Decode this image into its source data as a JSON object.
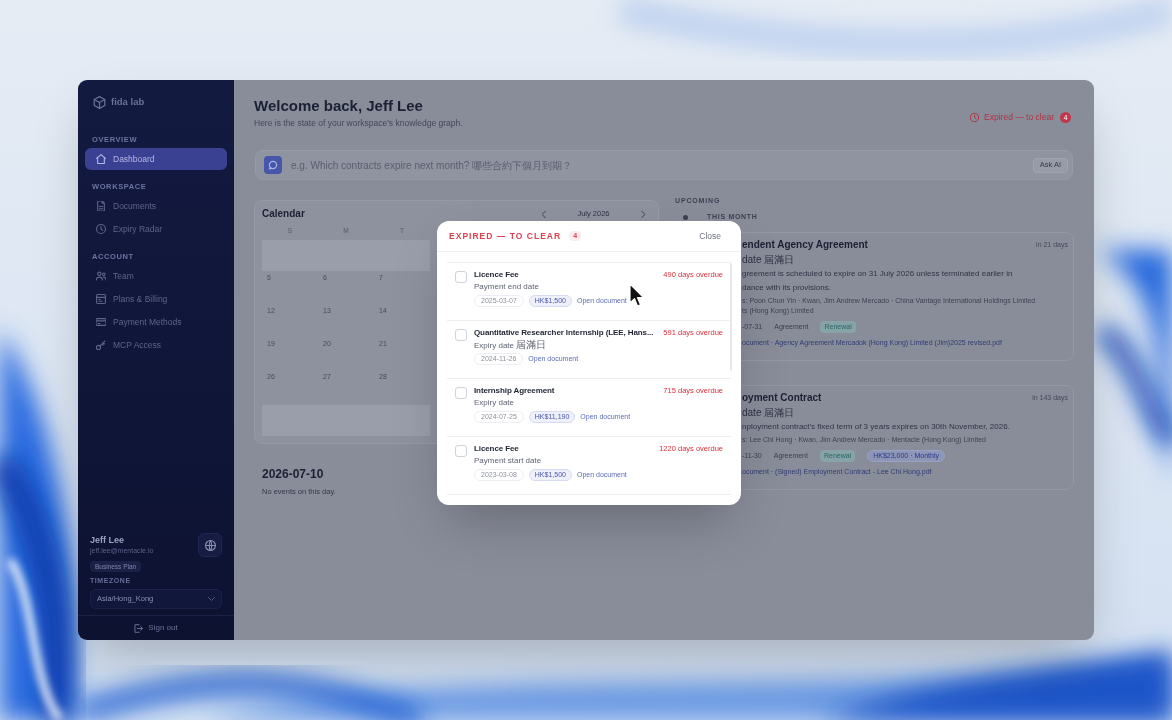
{
  "sidebar": {
    "logo": "fida lab",
    "sections": [
      {
        "heading": "OVERVIEW",
        "items": [
          {
            "label": "Dashboard",
            "selected": true
          }
        ]
      },
      {
        "heading": "WORKSPACE",
        "items": [
          {
            "label": "Documents",
            "selected": false
          },
          {
            "label": "Expiry Radar",
            "selected": false
          }
        ]
      },
      {
        "heading": "ACCOUNT",
        "items": [
          {
            "label": "Team",
            "selected": false
          },
          {
            "label": "Plans & Billing",
            "selected": false
          },
          {
            "label": "Payment Methods",
            "selected": false
          },
          {
            "label": "MCP Access",
            "selected": false
          }
        ]
      }
    ],
    "user": {
      "name": "Jeff Lee",
      "email": "jeff.lee@mentacle.io",
      "plan": "Business Plan"
    },
    "timezone": {
      "label": "TIMEZONE",
      "value": "Asia/Hong_Kong"
    },
    "sign_out": "Sign out"
  },
  "header": {
    "title": "Welcome back, Jeff Lee",
    "subtitle": "Here is the state of your workspace's knowledge graph.",
    "expired_link": {
      "label": "Expired — to clear",
      "count": "4"
    }
  },
  "ask_bar": {
    "placeholder": "e.g. Which contracts expire next month? 哪些合約下個月到期？",
    "button": "Ask AI"
  },
  "calendar": {
    "title": "Calendar",
    "month": "July 2026",
    "weekdays": [
      "S",
      "M",
      "T"
    ],
    "weeks": [
      [
        {
          "kind": "blank"
        },
        {
          "kind": "blank"
        },
        {
          "kind": "blank"
        }
      ],
      [
        {
          "kind": "day",
          "day": "5"
        },
        {
          "kind": "day",
          "day": "6"
        },
        {
          "kind": "day",
          "day": "7"
        }
      ],
      [
        {
          "kind": "day",
          "day": "12"
        },
        {
          "kind": "day",
          "day": "13"
        },
        {
          "kind": "day",
          "day": "14"
        }
      ],
      [
        {
          "kind": "day",
          "day": "19"
        },
        {
          "kind": "day",
          "day": "20"
        },
        {
          "kind": "day",
          "day": "21"
        }
      ],
      [
        {
          "kind": "day",
          "day": "26"
        },
        {
          "kind": "day",
          "day": "27"
        },
        {
          "kind": "day",
          "day": "28"
        }
      ],
      [
        {
          "kind": "blank"
        },
        {
          "kind": "blank"
        },
        {
          "kind": "blank"
        }
      ]
    ]
  },
  "selected_day": {
    "date": "2026-07-10",
    "message": "No events on this day."
  },
  "upcoming": {
    "heading": "UPCOMING",
    "group": "THIS MONTH",
    "cards": [
      {
        "title": "endent Agency Agreement",
        "due": "in 21 days",
        "subtitle": "date 屆滿日",
        "description": [
          "greement is scheduled to expire on 31 July 2026 unless terminated earlier in",
          "dance with its provisions."
        ],
        "parties": [
          "s: Poon Chun Yin · Kwan, Jim Andrew Mercado · China Vantage International Holdings Limited",
          "ts (Hong Kong) Limited"
        ],
        "date": "-07-31",
        "tags": [
          {
            "kind": "plain",
            "label": "Agreement"
          },
          {
            "kind": "renewal",
            "label": "Renewal"
          }
        ],
        "document": "ocument · Agency Agreement Mercadok (Hong Kong) Limited (Jim)2025 revised.pdf"
      },
      {
        "title": "oyment Contract",
        "due": "in 143 days",
        "subtitle": "date 屆滿日",
        "description": [
          "nployment contract's fixed term of 3 years expires on 30th November, 2026."
        ],
        "parties": [
          "s: Lee Chi Hong · Kwan, Jim Andrew Mercado · Mentacle (Hong Kong) Limited"
        ],
        "date": "-11-30",
        "tags": [
          {
            "kind": "plain",
            "label": "Agreement"
          },
          {
            "kind": "renewal",
            "label": "Renewal"
          },
          {
            "kind": "amount",
            "label": "HK$23,000 · Monthly"
          }
        ],
        "document": "ocument · (Signed) Employment Contract - Lee Chi Hong.pdf"
      }
    ]
  },
  "modal": {
    "title": "EXPIRED — TO CLEAR",
    "count": "4",
    "close": "Close",
    "items": [
      {
        "checked": false,
        "title": "Licence Fee",
        "subtitle": "Payment end date",
        "overdue": "490 days overdue",
        "date": "2025-03-07",
        "amount": "HK$1,500",
        "link": "Open document"
      },
      {
        "checked": false,
        "title": "Quantitative Researcher Internship (LEE, Hans...",
        "subtitle": "Expiry date 屆滿日",
        "overdue": "591 days overdue",
        "date": "2024-11-26",
        "link": "Open document"
      },
      {
        "checked": false,
        "title": "Internship Agreement",
        "subtitle": "Expiry date",
        "overdue": "715 days overdue",
        "date": "2024-07-25",
        "amount": "HK$11,190",
        "link": "Open document"
      },
      {
        "checked": false,
        "title": "Licence Fee",
        "subtitle": "Payment start date",
        "overdue": "1220 days overdue",
        "date": "2023-03-08",
        "amount": "HK$1,500",
        "link": "Open document"
      }
    ]
  }
}
